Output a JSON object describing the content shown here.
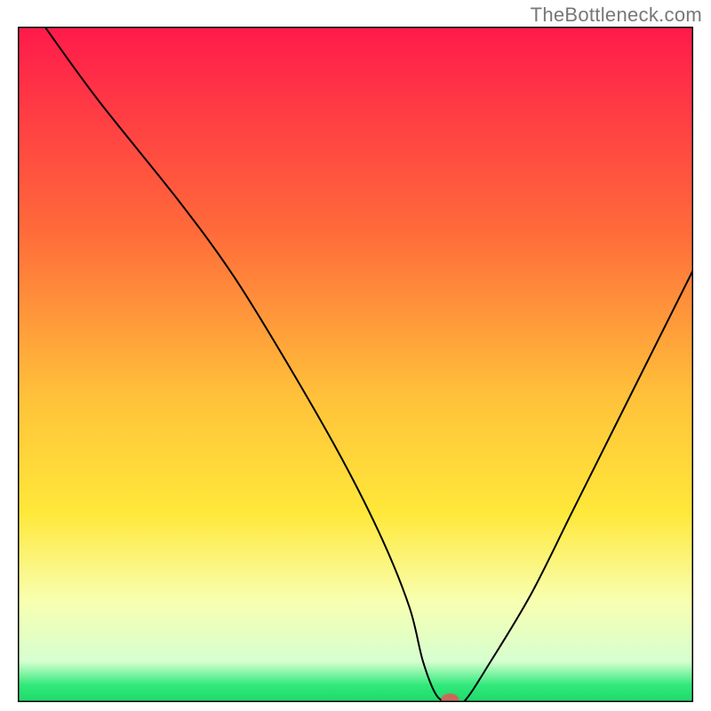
{
  "watermark": "TheBottleneck.com",
  "chart_data": {
    "type": "line",
    "title": "",
    "xlabel": "",
    "ylabel": "",
    "xlim": [
      0,
      100
    ],
    "ylim": [
      0,
      100
    ],
    "grid": false,
    "legend": false,
    "gradient_stops": [
      {
        "offset": 0.0,
        "color": "#ff1a4b"
      },
      {
        "offset": 0.3,
        "color": "#ff6a3a"
      },
      {
        "offset": 0.55,
        "color": "#ffc23a"
      },
      {
        "offset": 0.72,
        "color": "#ffe83a"
      },
      {
        "offset": 0.85,
        "color": "#f8ffb0"
      },
      {
        "offset": 0.94,
        "color": "#d6ffd0"
      },
      {
        "offset": 0.975,
        "color": "#30e97a"
      },
      {
        "offset": 1.0,
        "color": "#1fd96a"
      }
    ],
    "series": [
      {
        "name": "curve",
        "x": [
          4,
          12,
          24,
          32,
          40,
          48,
          54,
          58,
          60,
          62,
          64,
          66,
          70,
          76,
          82,
          88,
          94,
          100
        ],
        "values": [
          100,
          89,
          74,
          63,
          50,
          36,
          24,
          14,
          6,
          1,
          0,
          0,
          6,
          16,
          28,
          40,
          52,
          64
        ]
      }
    ],
    "marker": {
      "x": 64,
      "y": 0,
      "rx": 10,
      "ry": 7,
      "color": "#c86a5a"
    },
    "frame_color": "#000000",
    "frame_width": 3,
    "line_color": "#000000",
    "line_width": 2
  }
}
